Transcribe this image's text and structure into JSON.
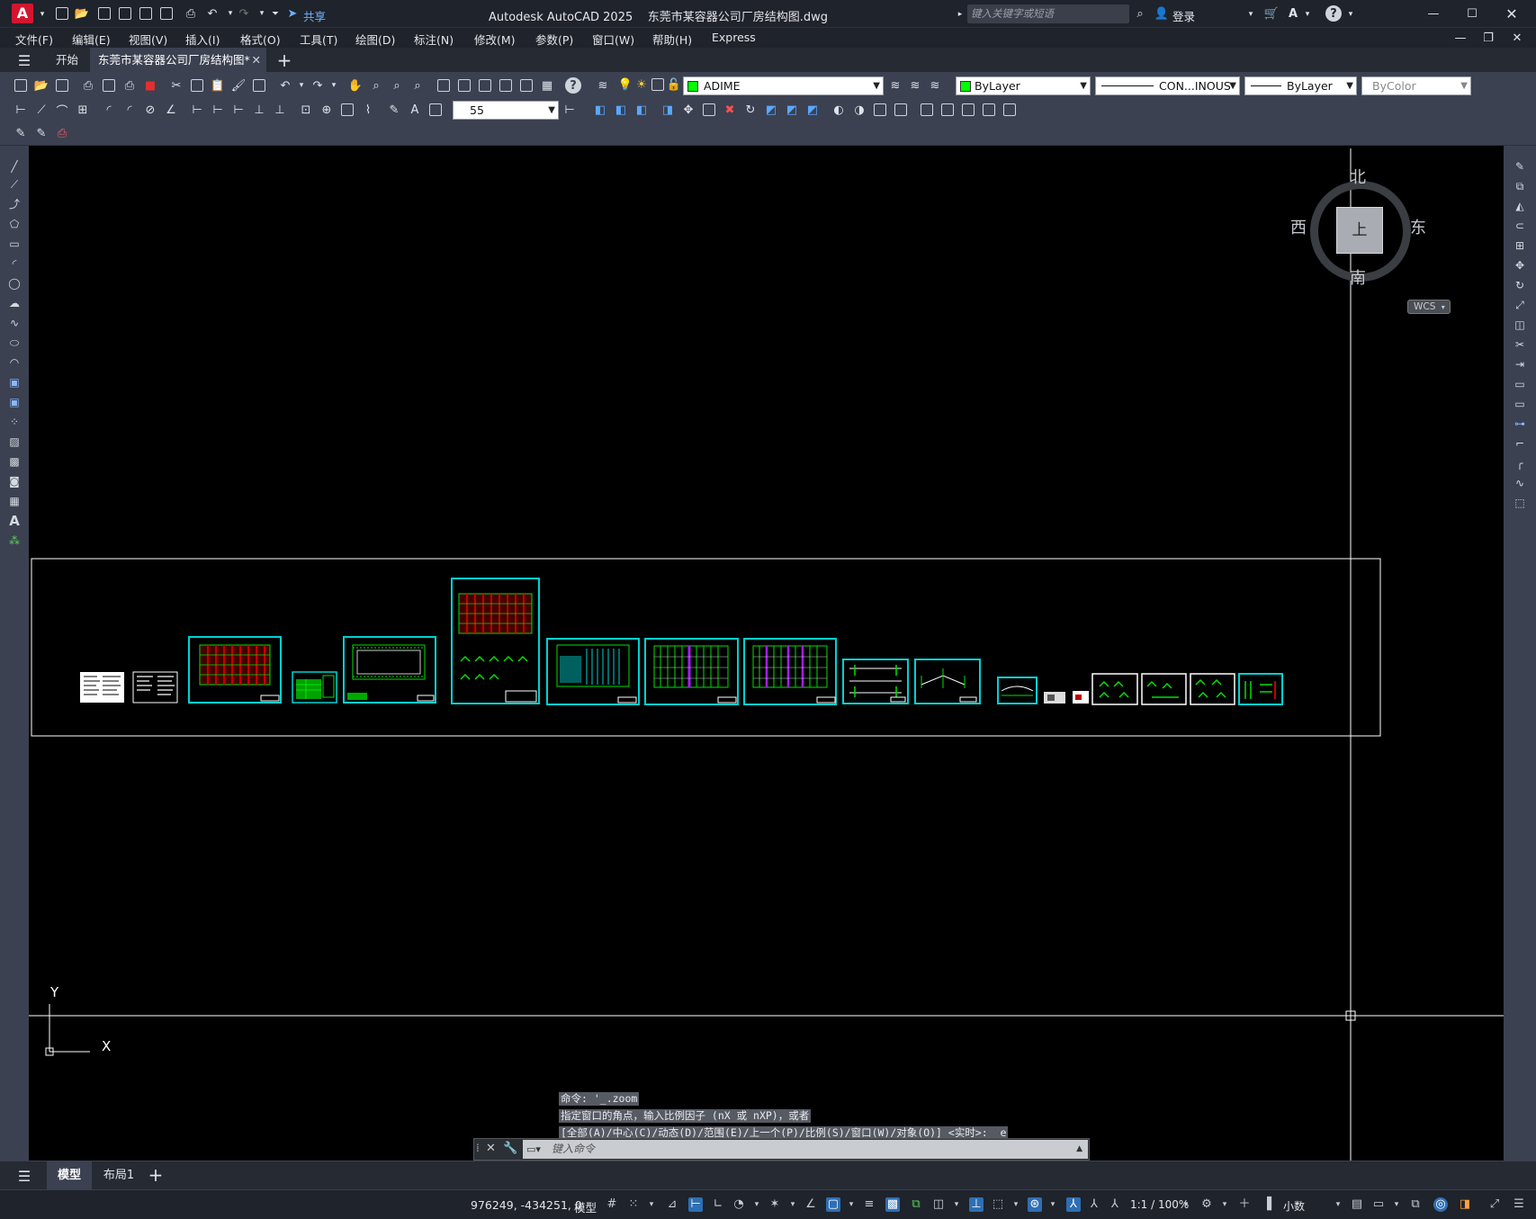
{
  "titlebar": {
    "app_letter": "A",
    "share_label": "共享",
    "title": "Autodesk AutoCAD 2025    东莞市某容器公司厂房结构图.dwg",
    "search_placeholder": "键入关键字或短语",
    "login_label": "登录",
    "icons": [
      "new-icon",
      "open-icon",
      "save-icon",
      "save-as-icon",
      "plot-icon",
      "undo-icon",
      "redo-icon",
      "share-icon",
      "search-icon",
      "user-icon",
      "cart-icon",
      "autodesk-icon",
      "help-icon",
      "minimize-icon",
      "maximize-icon",
      "close-icon"
    ]
  },
  "menubar": {
    "items": [
      "文件(F)",
      "编辑(E)",
      "视图(V)",
      "插入(I)",
      "格式(O)",
      "工具(T)",
      "绘图(D)",
      "标注(N)",
      "修改(M)",
      "参数(P)",
      "窗口(W)",
      "帮助(H)",
      "Express"
    ]
  },
  "tabs": {
    "items": [
      {
        "label": "开始",
        "active": false
      },
      {
        "label": "东莞市某容器公司厂房结构图*",
        "active": true
      }
    ],
    "add_label": "+"
  },
  "toolbar": {
    "layer_value": "ADIME",
    "layer_color": "#00ff00",
    "color_value": "ByLayer",
    "linetype_value": "CON...INOUS",
    "lineweight_value": "ByLayer",
    "plotstyle_value": "ByColor",
    "dimscale_value": "55"
  },
  "viewcube": {
    "north": "北",
    "south": "南",
    "east": "东",
    "west": "西",
    "face": "上",
    "wcs_label": "WCS"
  },
  "ucs": {
    "x": "X",
    "y": "Y"
  },
  "command": {
    "lines": [
      "命令: '_.zoom",
      "指定窗口的角点，输入比例因子 (nX 或 nXP)，或者",
      "[全部(A)/中心(C)/动态(D)/范围(E)/上一个(P)/比例(S)/窗口(W)/对象(O)] <实时>: _e"
    ],
    "placeholder": "键入命令"
  },
  "layout_tabs": {
    "items": [
      {
        "label": "模型",
        "active": true
      },
      {
        "label": "布局1",
        "active": false
      }
    ],
    "add_label": "+"
  },
  "status": {
    "coordinates": "976249, -434251, 0",
    "model_label": "模型",
    "scale_label": "1:1 / 100%",
    "units_label": "小数"
  },
  "colors": {
    "sheet_border": "#00d2d2",
    "drawing_green": "#00e000",
    "drawing_red": "#c00000",
    "drawing_purple": "#a020f0",
    "accent": "#2e6fb5",
    "app_red": "#d3162f"
  }
}
